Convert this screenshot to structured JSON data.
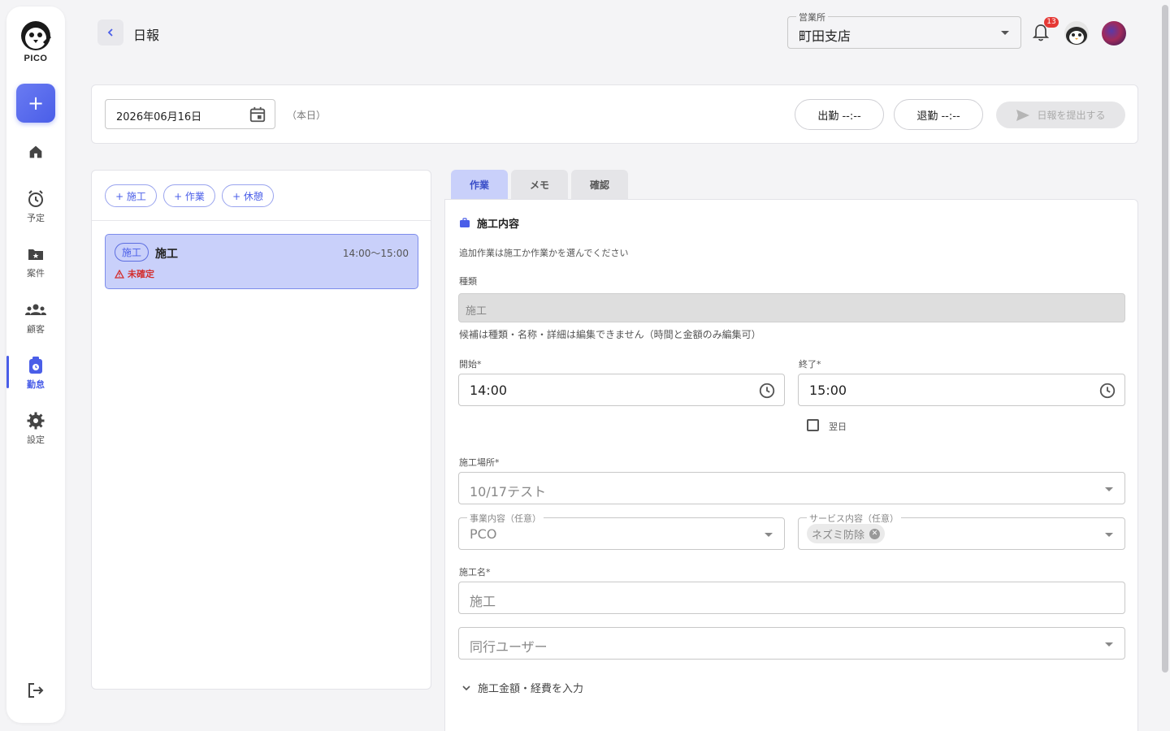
{
  "sidebar": {
    "logo_text": "PICO",
    "add_label": "+",
    "nav": [
      {
        "id": "home",
        "label": ""
      },
      {
        "id": "schedule",
        "label": "予定"
      },
      {
        "id": "projects",
        "label": "案件"
      },
      {
        "id": "customers",
        "label": "顧客"
      },
      {
        "id": "attendance",
        "label": "勤怠"
      },
      {
        "id": "settings",
        "label": "設定"
      }
    ]
  },
  "header": {
    "title": "日報",
    "office_label": "営業所",
    "office_value": "町田支店",
    "notification_count": "13"
  },
  "datebar": {
    "date": "2026年06月16日",
    "today": "（本日）",
    "clock_in": "出勤 --:--",
    "clock_out": "退勤 --:--",
    "submit": "日報を提出する"
  },
  "left": {
    "add_buttons": [
      "+ 施工",
      "+ 作業",
      "+ 休憩"
    ],
    "entry": {
      "tag": "施工",
      "title": "施工",
      "time": "14:00〜15:00",
      "status": "未確定"
    }
  },
  "tabs": [
    "作業",
    "メモ",
    "確認"
  ],
  "form": {
    "section_title": "施工内容",
    "hint": "追加作業は施工か作業かを選んでください",
    "type_label": "種類",
    "type_value": "施工",
    "note": "候補は種類・名称・詳細は編集できません（時間と金額のみ編集可）",
    "start_label": "開始*",
    "start_value": "14:00",
    "end_label": "終了*",
    "end_value": "15:00",
    "next_day": "翌日",
    "location_label": "施工場所*",
    "location_value": "10/17テスト",
    "business_label": "事業内容（任意）",
    "business_value": "PCO",
    "service_label": "サービス内容（任意）",
    "service_chip": "ネズミ防除",
    "name_label": "施工名*",
    "name_value": "施工",
    "users_placeholder": "同行ユーザー",
    "expander": "施工金額・経費を入力"
  },
  "colors": {
    "accent": "#4a5ee8",
    "selected": "#c9d0fa",
    "warning": "#d32f2f"
  }
}
